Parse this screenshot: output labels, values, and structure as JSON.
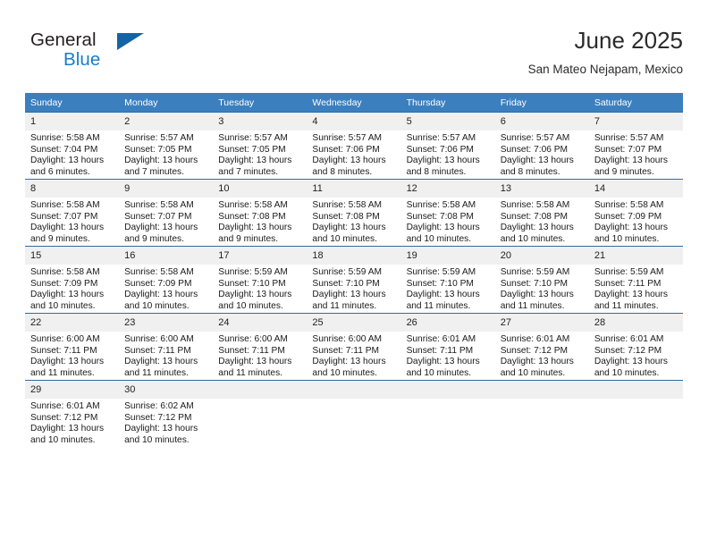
{
  "brand": {
    "name_part1": "General",
    "name_part2": "Blue",
    "mark_icon": "triangle-logo-icon"
  },
  "header": {
    "title": "June 2025",
    "subtitle": "San Mateo Nejapam, Mexico"
  },
  "calendar": {
    "weekday_headers": [
      "Sunday",
      "Monday",
      "Tuesday",
      "Wednesday",
      "Thursday",
      "Friday",
      "Saturday"
    ],
    "header_bg": "#3b7fbf",
    "row_border": "#2e6da4",
    "daynum_bg": "#f0f0f0",
    "weeks": [
      [
        {
          "day": "1",
          "sunrise": "Sunrise: 5:58 AM",
          "sunset": "Sunset: 7:04 PM",
          "daylight": "Daylight: 13 hours and 6 minutes."
        },
        {
          "day": "2",
          "sunrise": "Sunrise: 5:57 AM",
          "sunset": "Sunset: 7:05 PM",
          "daylight": "Daylight: 13 hours and 7 minutes."
        },
        {
          "day": "3",
          "sunrise": "Sunrise: 5:57 AM",
          "sunset": "Sunset: 7:05 PM",
          "daylight": "Daylight: 13 hours and 7 minutes."
        },
        {
          "day": "4",
          "sunrise": "Sunrise: 5:57 AM",
          "sunset": "Sunset: 7:06 PM",
          "daylight": "Daylight: 13 hours and 8 minutes."
        },
        {
          "day": "5",
          "sunrise": "Sunrise: 5:57 AM",
          "sunset": "Sunset: 7:06 PM",
          "daylight": "Daylight: 13 hours and 8 minutes."
        },
        {
          "day": "6",
          "sunrise": "Sunrise: 5:57 AM",
          "sunset": "Sunset: 7:06 PM",
          "daylight": "Daylight: 13 hours and 8 minutes."
        },
        {
          "day": "7",
          "sunrise": "Sunrise: 5:57 AM",
          "sunset": "Sunset: 7:07 PM",
          "daylight": "Daylight: 13 hours and 9 minutes."
        }
      ],
      [
        {
          "day": "8",
          "sunrise": "Sunrise: 5:58 AM",
          "sunset": "Sunset: 7:07 PM",
          "daylight": "Daylight: 13 hours and 9 minutes."
        },
        {
          "day": "9",
          "sunrise": "Sunrise: 5:58 AM",
          "sunset": "Sunset: 7:07 PM",
          "daylight": "Daylight: 13 hours and 9 minutes."
        },
        {
          "day": "10",
          "sunrise": "Sunrise: 5:58 AM",
          "sunset": "Sunset: 7:08 PM",
          "daylight": "Daylight: 13 hours and 9 minutes."
        },
        {
          "day": "11",
          "sunrise": "Sunrise: 5:58 AM",
          "sunset": "Sunset: 7:08 PM",
          "daylight": "Daylight: 13 hours and 10 minutes."
        },
        {
          "day": "12",
          "sunrise": "Sunrise: 5:58 AM",
          "sunset": "Sunset: 7:08 PM",
          "daylight": "Daylight: 13 hours and 10 minutes."
        },
        {
          "day": "13",
          "sunrise": "Sunrise: 5:58 AM",
          "sunset": "Sunset: 7:08 PM",
          "daylight": "Daylight: 13 hours and 10 minutes."
        },
        {
          "day": "14",
          "sunrise": "Sunrise: 5:58 AM",
          "sunset": "Sunset: 7:09 PM",
          "daylight": "Daylight: 13 hours and 10 minutes."
        }
      ],
      [
        {
          "day": "15",
          "sunrise": "Sunrise: 5:58 AM",
          "sunset": "Sunset: 7:09 PM",
          "daylight": "Daylight: 13 hours and 10 minutes."
        },
        {
          "day": "16",
          "sunrise": "Sunrise: 5:58 AM",
          "sunset": "Sunset: 7:09 PM",
          "daylight": "Daylight: 13 hours and 10 minutes."
        },
        {
          "day": "17",
          "sunrise": "Sunrise: 5:59 AM",
          "sunset": "Sunset: 7:10 PM",
          "daylight": "Daylight: 13 hours and 10 minutes."
        },
        {
          "day": "18",
          "sunrise": "Sunrise: 5:59 AM",
          "sunset": "Sunset: 7:10 PM",
          "daylight": "Daylight: 13 hours and 11 minutes."
        },
        {
          "day": "19",
          "sunrise": "Sunrise: 5:59 AM",
          "sunset": "Sunset: 7:10 PM",
          "daylight": "Daylight: 13 hours and 11 minutes."
        },
        {
          "day": "20",
          "sunrise": "Sunrise: 5:59 AM",
          "sunset": "Sunset: 7:10 PM",
          "daylight": "Daylight: 13 hours and 11 minutes."
        },
        {
          "day": "21",
          "sunrise": "Sunrise: 5:59 AM",
          "sunset": "Sunset: 7:11 PM",
          "daylight": "Daylight: 13 hours and 11 minutes."
        }
      ],
      [
        {
          "day": "22",
          "sunrise": "Sunrise: 6:00 AM",
          "sunset": "Sunset: 7:11 PM",
          "daylight": "Daylight: 13 hours and 11 minutes."
        },
        {
          "day": "23",
          "sunrise": "Sunrise: 6:00 AM",
          "sunset": "Sunset: 7:11 PM",
          "daylight": "Daylight: 13 hours and 11 minutes."
        },
        {
          "day": "24",
          "sunrise": "Sunrise: 6:00 AM",
          "sunset": "Sunset: 7:11 PM",
          "daylight": "Daylight: 13 hours and 11 minutes."
        },
        {
          "day": "25",
          "sunrise": "Sunrise: 6:00 AM",
          "sunset": "Sunset: 7:11 PM",
          "daylight": "Daylight: 13 hours and 10 minutes."
        },
        {
          "day": "26",
          "sunrise": "Sunrise: 6:01 AM",
          "sunset": "Sunset: 7:11 PM",
          "daylight": "Daylight: 13 hours and 10 minutes."
        },
        {
          "day": "27",
          "sunrise": "Sunrise: 6:01 AM",
          "sunset": "Sunset: 7:12 PM",
          "daylight": "Daylight: 13 hours and 10 minutes."
        },
        {
          "day": "28",
          "sunrise": "Sunrise: 6:01 AM",
          "sunset": "Sunset: 7:12 PM",
          "daylight": "Daylight: 13 hours and 10 minutes."
        }
      ],
      [
        {
          "day": "29",
          "sunrise": "Sunrise: 6:01 AM",
          "sunset": "Sunset: 7:12 PM",
          "daylight": "Daylight: 13 hours and 10 minutes."
        },
        {
          "day": "30",
          "sunrise": "Sunrise: 6:02 AM",
          "sunset": "Sunset: 7:12 PM",
          "daylight": "Daylight: 13 hours and 10 minutes."
        },
        {
          "day": "",
          "sunrise": "",
          "sunset": "",
          "daylight": ""
        },
        {
          "day": "",
          "sunrise": "",
          "sunset": "",
          "daylight": ""
        },
        {
          "day": "",
          "sunrise": "",
          "sunset": "",
          "daylight": ""
        },
        {
          "day": "",
          "sunrise": "",
          "sunset": "",
          "daylight": ""
        },
        {
          "day": "",
          "sunrise": "",
          "sunset": "",
          "daylight": ""
        }
      ]
    ]
  }
}
